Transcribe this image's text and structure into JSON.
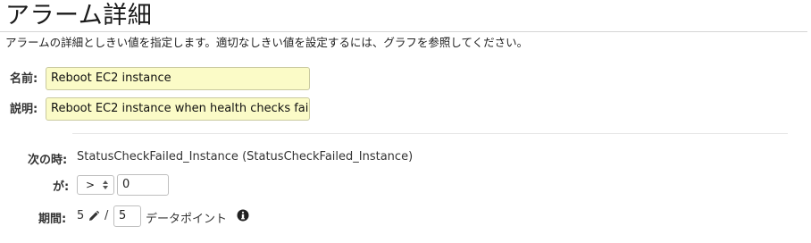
{
  "header": {
    "title": "アラーム詳細",
    "description": "アラームの詳細としきい値を指定します。適切なしきい値を設定するには、グラフを参照してください。"
  },
  "form": {
    "name_label": "名前:",
    "name_value": "Reboot EC2 instance",
    "description_label": "説明:",
    "description_value": "Reboot EC2 instance when health checks fai"
  },
  "condition": {
    "when_label": "次の時:",
    "metric": "StatusCheckFailed_Instance (StatusCheckFailed_Instance)",
    "is_label": "が:",
    "operator": ">",
    "threshold": "0",
    "period_label": "期間:",
    "period_value": "5",
    "separator": "/",
    "datapoints_value": "5",
    "datapoints_unit": "データポイント"
  },
  "icons": {
    "edit": "pencil-icon",
    "info": "info-icon",
    "select": "chevron-updown-icon"
  }
}
